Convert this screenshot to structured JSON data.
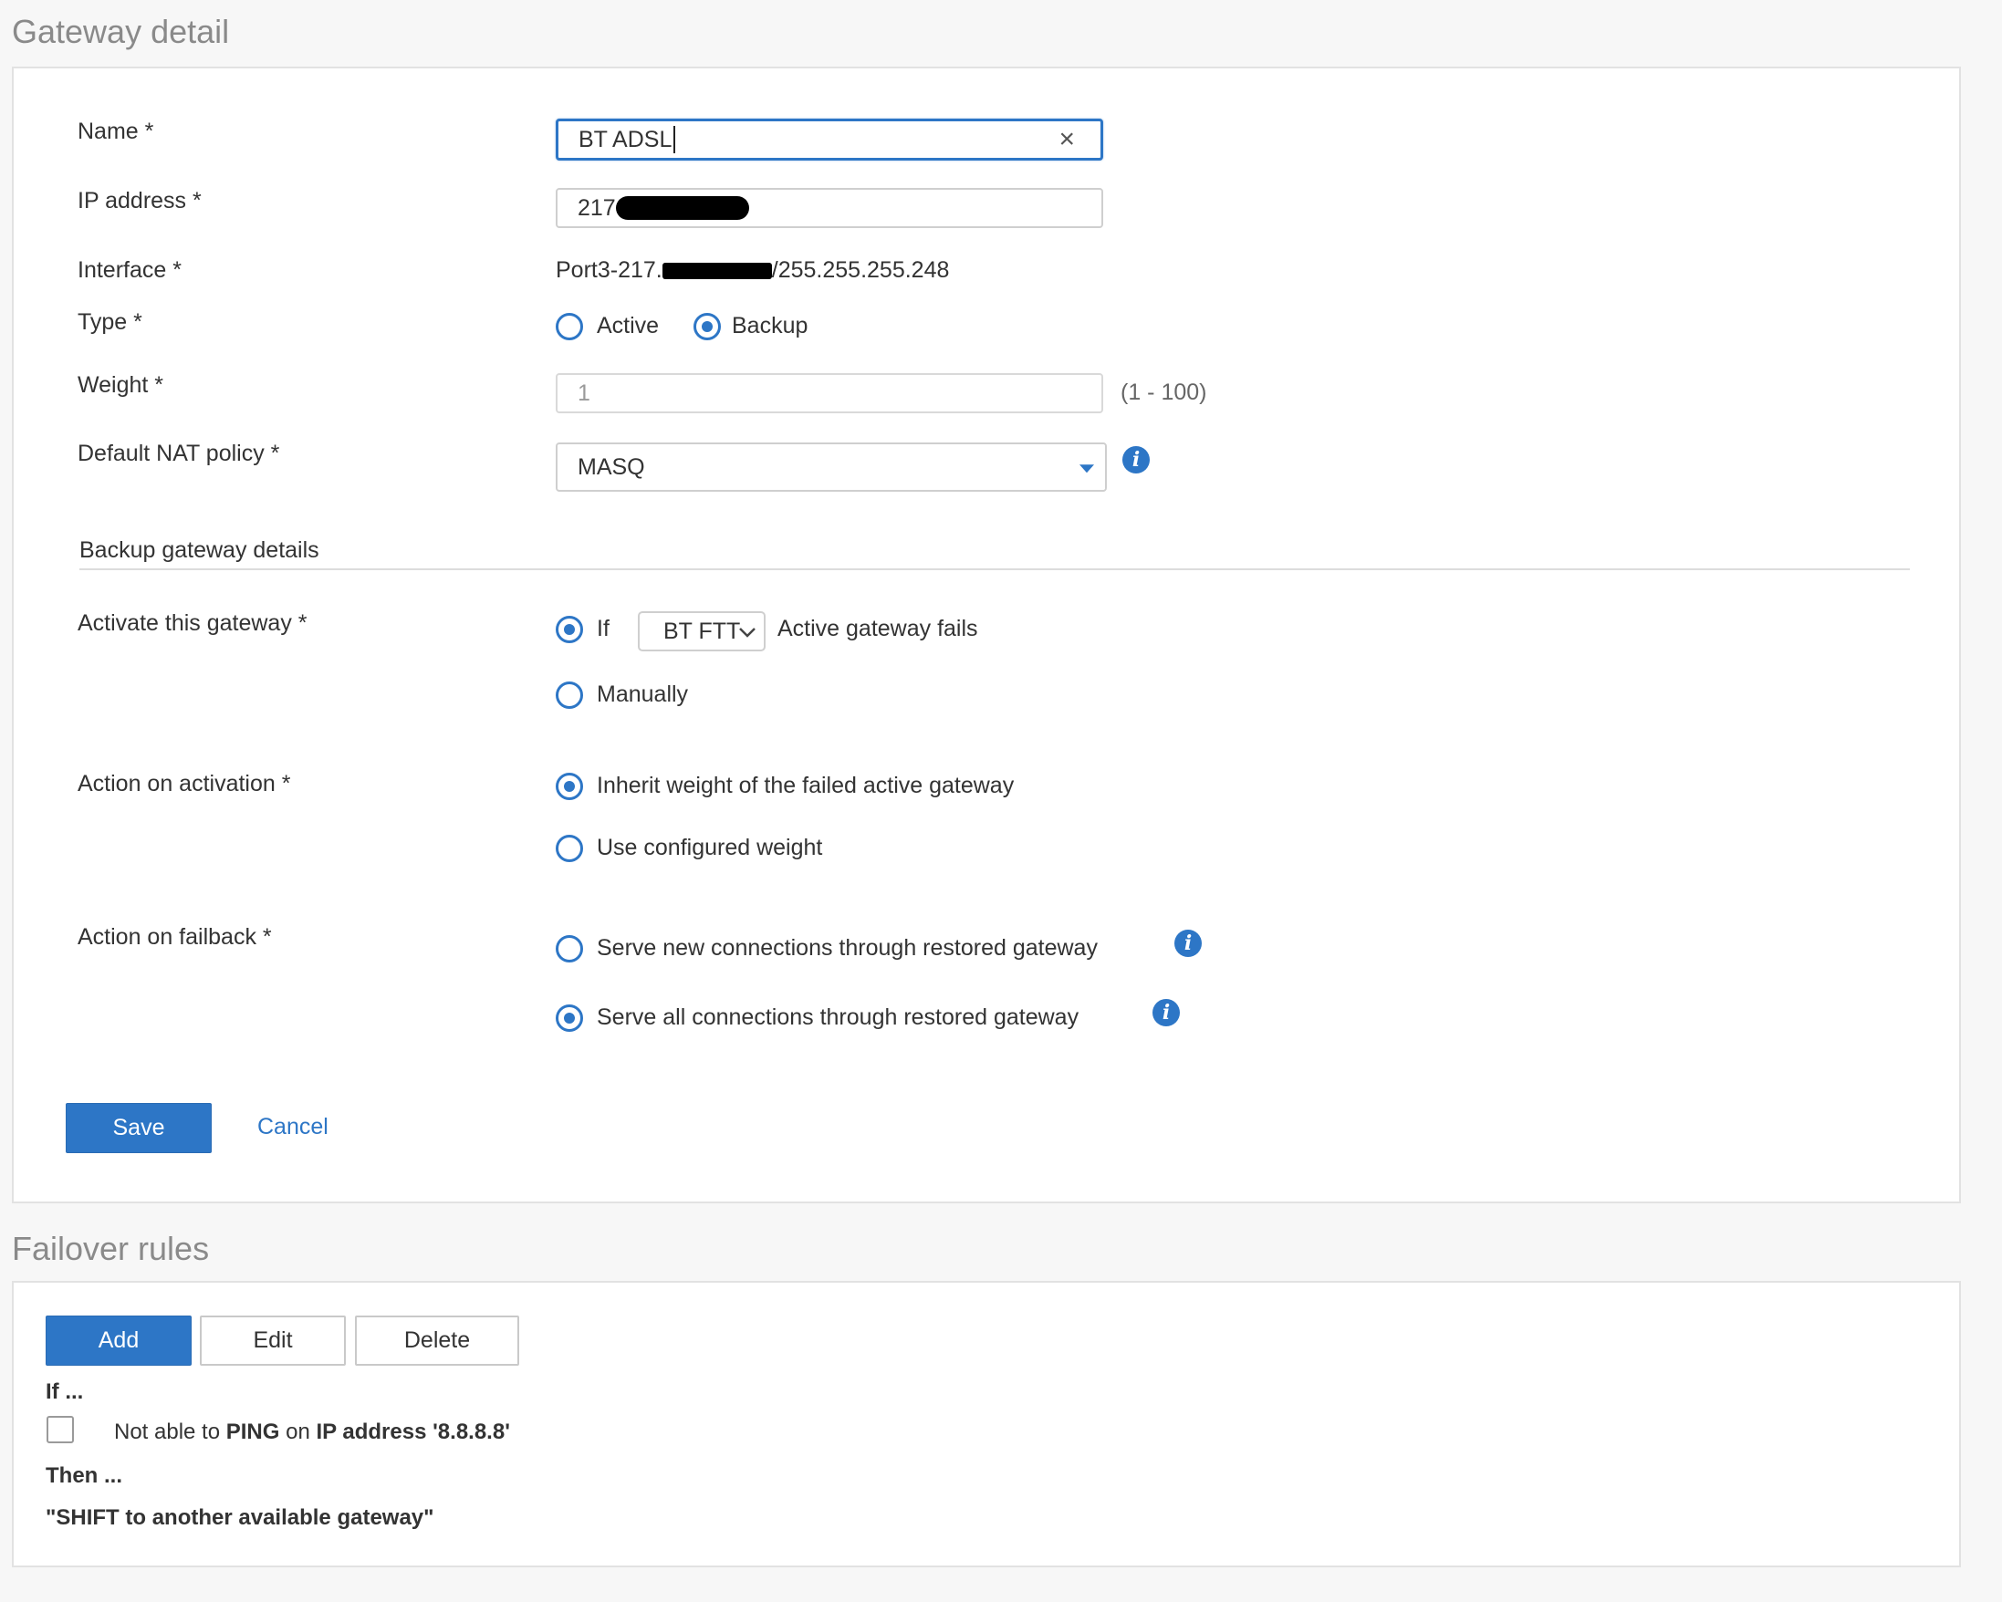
{
  "gateway_detail": {
    "title": "Gateway detail",
    "name_label": "Name *",
    "name_value": "BT ADSL",
    "ip_label": "IP address *",
    "ip_value_prefix": "217",
    "interface_label": "Interface *",
    "interface_prefix": "Port3-217.",
    "interface_suffix": "/255.255.255.248",
    "type_label": "Type *",
    "type_options": [
      "Active",
      "Backup"
    ],
    "type_selected": "Backup",
    "weight_label": "Weight *",
    "weight_value": "1",
    "weight_range": "(1 - 100)",
    "nat_label": "Default NAT policy *",
    "nat_value": "MASQ",
    "backup_section_title": "Backup gateway details",
    "activate_label": "Activate this gateway *",
    "activate_if": "If",
    "activate_gateway_select": "BT FTT",
    "activate_fails": "Active gateway fails",
    "activate_manually": "Manually",
    "activation_label": "Action on activation *",
    "activation_inherit": "Inherit weight of the failed active gateway",
    "activation_configured": "Use configured weight",
    "failback_label": "Action on failback *",
    "failback_new": "Serve new connections through restored gateway",
    "failback_all": "Serve all connections through restored gateway",
    "save": "Save",
    "cancel": "Cancel",
    "info_glyph": "i",
    "clear_glyph": "×"
  },
  "failover_rules": {
    "title": "Failover rules",
    "add": "Add",
    "edit": "Edit",
    "delete": "Delete",
    "if_label": "If ...",
    "rule_text_1": "Not able to ",
    "rule_text_2": "PING",
    "rule_text_3": " on ",
    "rule_text_4": "IP address '8.8.8.8'",
    "then_label": "Then ...",
    "then_action": "\"SHIFT to another available gateway\""
  },
  "colors": {
    "accent": "#2d76c6",
    "background": "#f7f7f7",
    "panel": "#ffffff",
    "title_gray": "#8a8a8a"
  }
}
